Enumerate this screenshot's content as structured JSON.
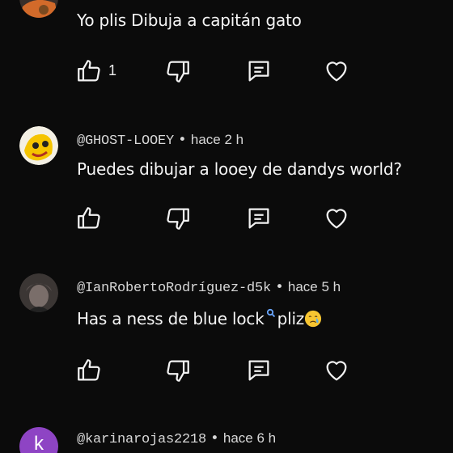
{
  "comments": [
    {
      "text": "Yo plis Dibuja a capitán gato",
      "like_count": "1"
    },
    {
      "handle": "@GHOST-LOOEY",
      "separator": " • ",
      "time": "hace 2 h",
      "text": "Puedes dibujar a looey de dandys world?",
      "like_count": ""
    },
    {
      "handle": "@IanRobertoRodríguez-d5k",
      "separator": " • ",
      "time": "hace 5 h",
      "text_part1": "Has a ness de blue lock",
      "text_part2": "pliz",
      "like_count": ""
    },
    {
      "avatar_letter": "k",
      "handle": "@karinarojas2218",
      "separator": " • ",
      "time": "hace 6 h"
    }
  ],
  "icons": {
    "like": "thumbs-up-icon",
    "dislike": "thumbs-down-icon",
    "reply": "reply-icon",
    "heart": "heart-icon",
    "search": "search-icon",
    "crying_emoji": "crying-face-emoji"
  },
  "colors": {
    "background": "#0b0b0b",
    "text": "#f1f1f1",
    "avatar_k": "#8e44c4",
    "search_blue": "#6aa7ff"
  }
}
